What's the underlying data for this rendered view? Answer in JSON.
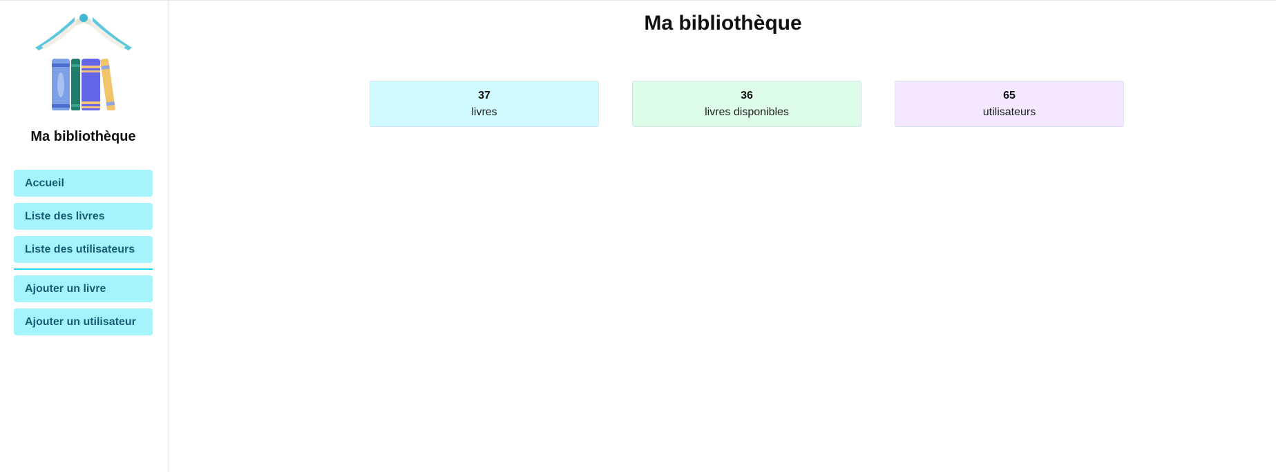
{
  "sidebar": {
    "title": "Ma bibliothèque",
    "logo_icon": "book-house-icon",
    "nav": [
      {
        "label": "Accueil"
      },
      {
        "label": "Liste des livres"
      },
      {
        "label": "Liste des utilisateurs"
      },
      {
        "label": "Ajouter un livre"
      },
      {
        "label": "Ajouter un utilisateur"
      }
    ]
  },
  "main": {
    "title": "Ma bibliothèque",
    "stats": [
      {
        "value": "37",
        "label": "livres",
        "color": "#cffafe"
      },
      {
        "value": "36",
        "label": "livres disponibles",
        "color": "#dcfce7"
      },
      {
        "value": "65",
        "label": "utilisateurs",
        "color": "#f3e8ff"
      }
    ]
  },
  "colors": {
    "nav_background": "#a5f3fc",
    "nav_text": "#155e75",
    "divider": "#22d3ee"
  }
}
